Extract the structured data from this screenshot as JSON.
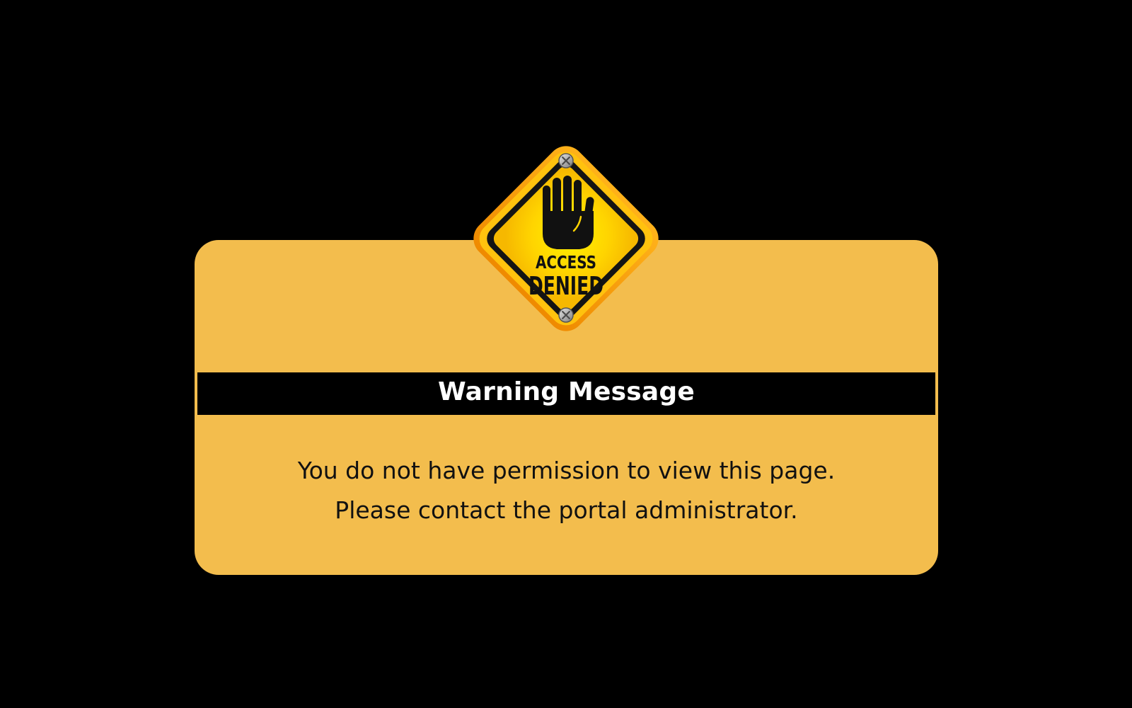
{
  "sign": {
    "line1": "ACCESS",
    "line2": "DENIED",
    "icon": "stop-hand-icon"
  },
  "warning": {
    "title": "Warning Message",
    "messages": [
      "You do not have permission to view this page.",
      "Please contact the portal administrator."
    ]
  },
  "colors": {
    "background": "#000000",
    "card": "#f3bd4d",
    "banner": "#000000",
    "banner_text": "#ffffff",
    "sign_yellow": "#ffd400",
    "sign_orange": "#f39200"
  }
}
